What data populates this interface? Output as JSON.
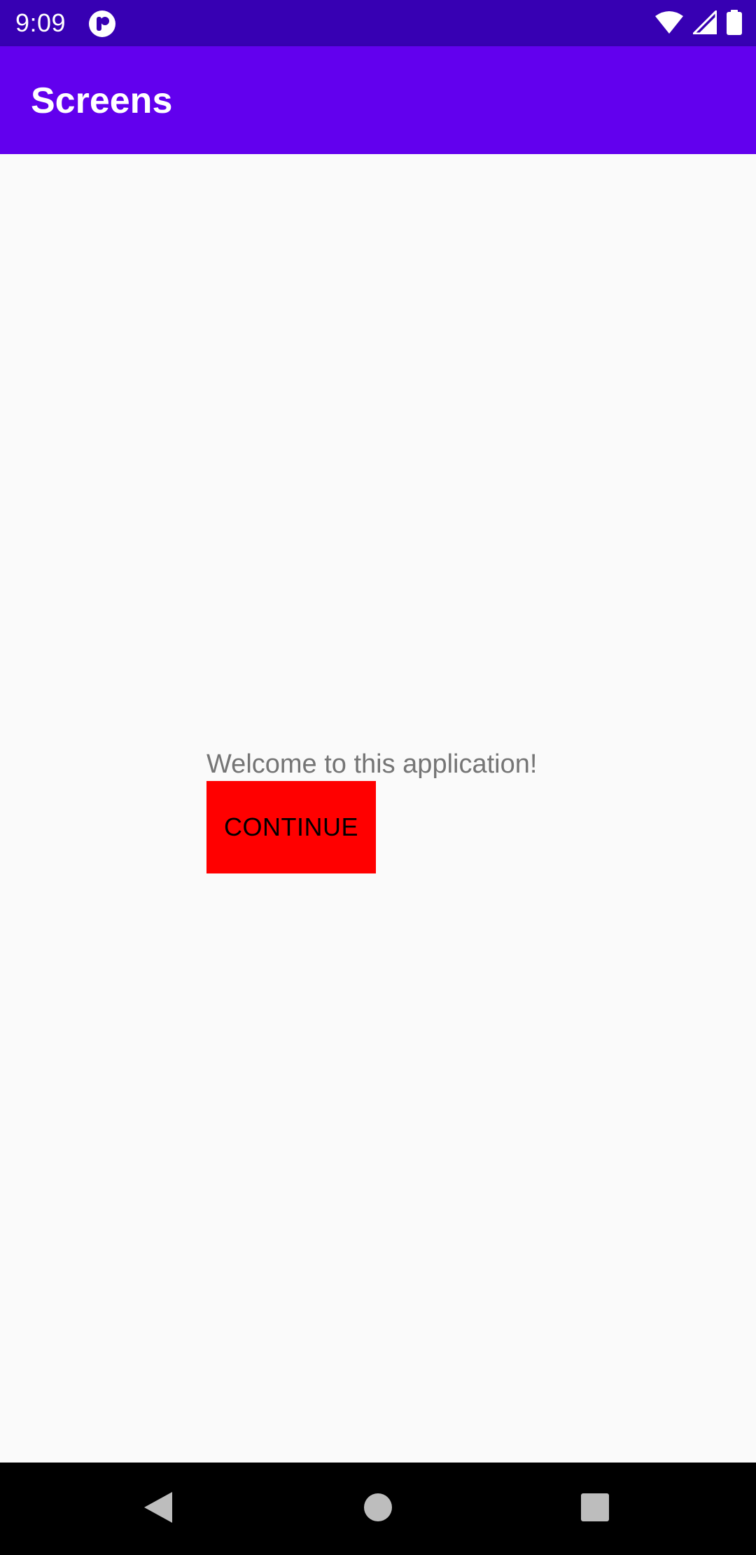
{
  "status_bar": {
    "time": "9:09",
    "app_icon": "notification-app-icon",
    "wifi_icon": "wifi-icon",
    "signal_icon": "cell-signal-icon",
    "battery_icon": "battery-icon",
    "background_color": "#3700B3"
  },
  "app_bar": {
    "title": "Screens",
    "background_color": "#6200EE"
  },
  "main": {
    "welcome_text": "Welcome to this application!",
    "continue_button": {
      "label": "CONTINUE",
      "background_color": "#FF0000"
    }
  },
  "nav_bar": {
    "back_icon": "back-triangle-icon",
    "home_icon": "home-circle-icon",
    "recents_icon": "recents-square-icon"
  }
}
